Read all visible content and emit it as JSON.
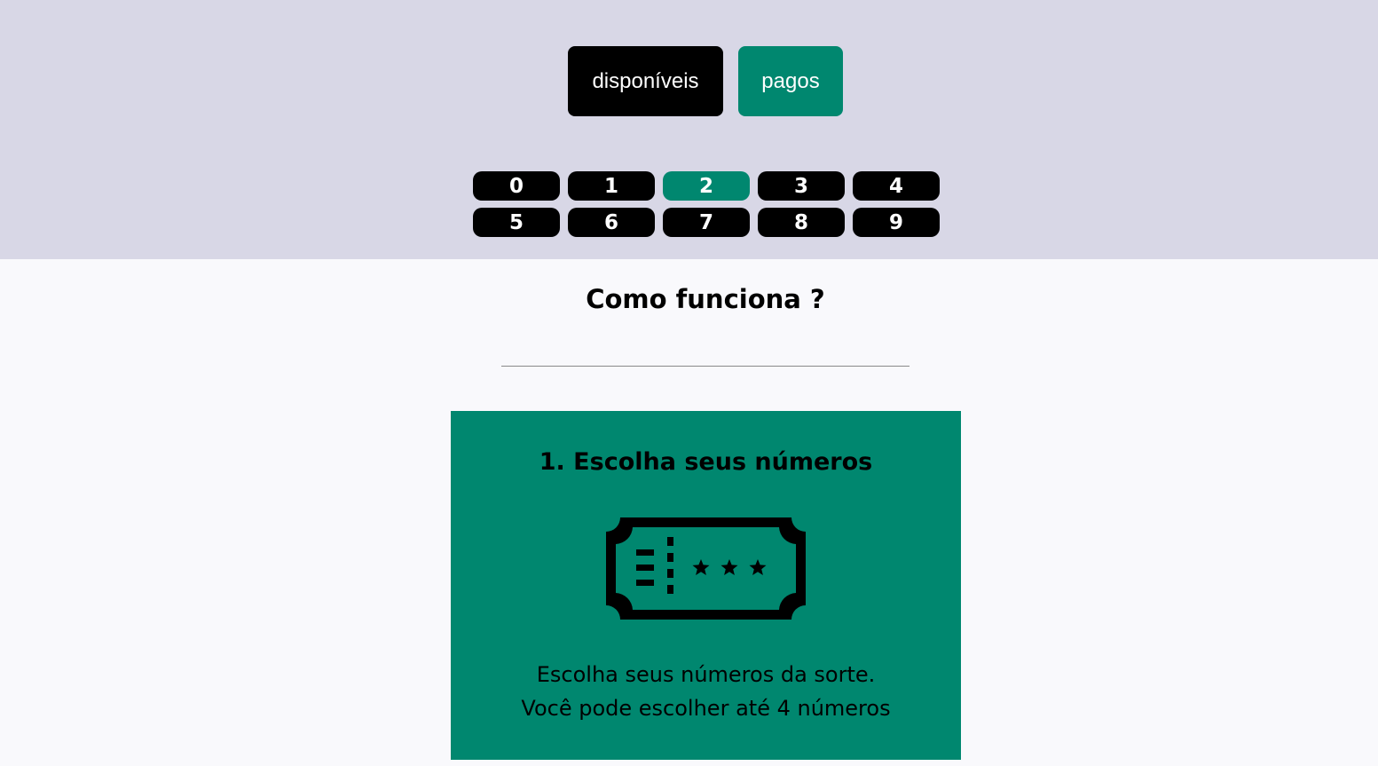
{
  "filters": {
    "available_label": "disponíveis",
    "paid_label": "pagos"
  },
  "numbers": [
    "0",
    "1",
    "2",
    "3",
    "4",
    "5",
    "6",
    "7",
    "8",
    "9"
  ],
  "selected_number": "2",
  "how_it_works": {
    "title": "Como funciona ?",
    "step1": {
      "title": "1. Escolha seus números",
      "icon": "ticket-icon",
      "line1": "Escolha seus números da sorte.",
      "line2": "Você pode escolher até 4 números"
    }
  },
  "colors": {
    "accent": "#00876f",
    "header_bg": "#d8d7e6",
    "page_bg": "#f9f9fc",
    "button_dark": "#000000"
  }
}
